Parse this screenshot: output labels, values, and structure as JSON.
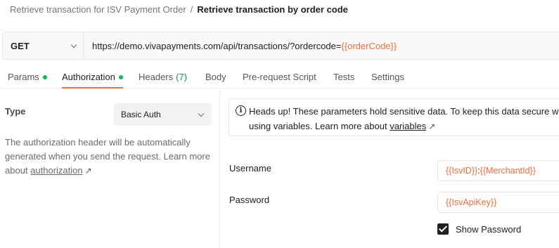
{
  "breadcrumb": {
    "parent": "Retrieve transaction for ISV Payment Order",
    "separator": "/",
    "current": "Retrieve transaction by order code"
  },
  "request": {
    "method": "GET",
    "url_base": "https://demo.vivapayments.com/api/transactions/?ordercode=",
    "url_variable": "{{orderCode}}"
  },
  "tabs": [
    {
      "label": "Params",
      "dot": true
    },
    {
      "label": "Authorization",
      "dot": true,
      "active": true
    },
    {
      "label": "Headers",
      "count": "(7)"
    },
    {
      "label": "Body"
    },
    {
      "label": "Pre-request Script"
    },
    {
      "label": "Tests"
    },
    {
      "label": "Settings"
    }
  ],
  "auth": {
    "type_label": "Type",
    "type_value": "Basic Auth",
    "description": "The authorization header will be automatically generated when you send the request. Learn more about ",
    "description_link": "authorization",
    "link_arrow": "↗"
  },
  "notice": {
    "icon": "info-icon",
    "line1": "Heads up! These parameters hold sensitive data. To keep this data secure wh",
    "line2": "using variables. Learn more about ",
    "link": "variables",
    "link_arrow": "↗"
  },
  "fields": {
    "username": {
      "label": "Username",
      "var1": "{{IsvID}}",
      "separator": ":",
      "var2": "{{MerchantId}}"
    },
    "password": {
      "label": "Password",
      "value": "{{IsvApiKey}}"
    }
  },
  "show_password": {
    "label": "Show Password",
    "checked": true
  },
  "colors": {
    "accent": "#f26b3a",
    "status_dot": "#0cbb52"
  }
}
